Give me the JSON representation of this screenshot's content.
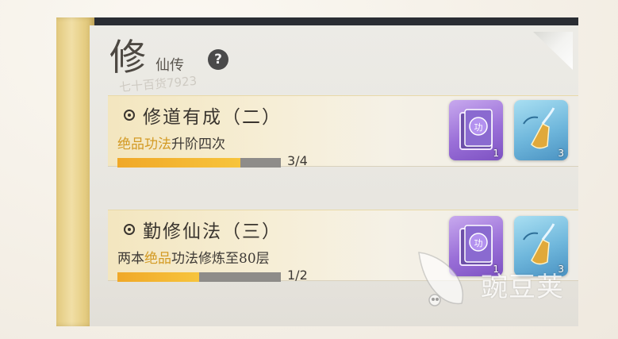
{
  "header": {
    "title_big": "修",
    "title_small": "仙传",
    "help_glyph": "?"
  },
  "watermark_faint": "七十百货7923",
  "quests": [
    {
      "title": "修道有成（二）",
      "desc_highlight": "绝品功法",
      "desc_rest": "升阶四次",
      "progress_text": "3/4",
      "progress": 0.75,
      "rewards": [
        {
          "type": "purple-book-icon",
          "count": "1"
        },
        {
          "type": "golden-whisk-icon",
          "count": "3"
        }
      ]
    },
    {
      "title": "勤修仙法（三）",
      "desc_prefix": "两本",
      "desc_highlight": "绝品",
      "desc_rest": "功法修炼至80层",
      "progress_text": "1/2",
      "progress": 0.5,
      "rewards": [
        {
          "type": "purple-book-icon",
          "count": "1"
        },
        {
          "type": "golden-whisk-icon",
          "count": "3"
        }
      ]
    }
  ],
  "brand_watermark": "豌豆荚",
  "colors": {
    "highlight": "#d39a24",
    "progress_fill": "#f7c43c",
    "progress_track": "#8e8c89"
  }
}
